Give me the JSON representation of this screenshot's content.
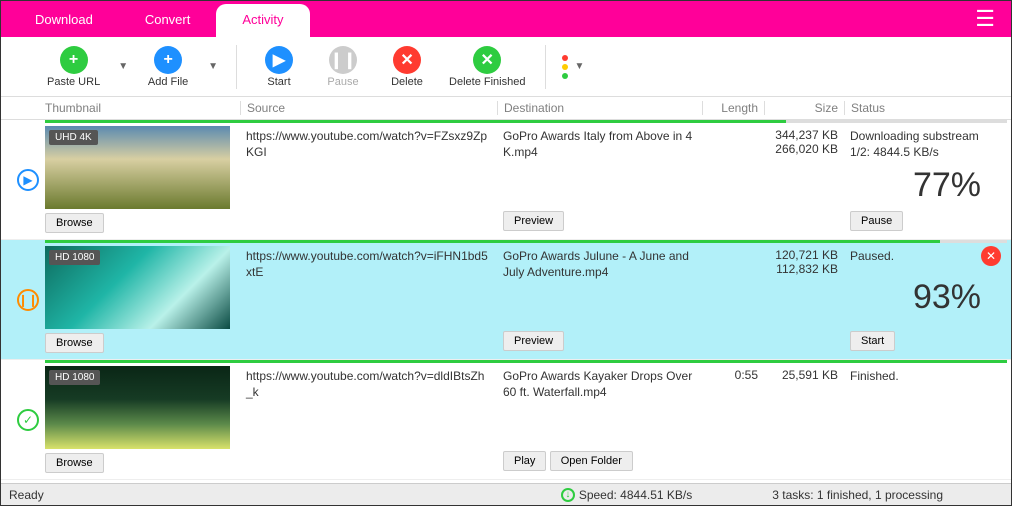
{
  "tabs": {
    "download": "Download",
    "convert": "Convert",
    "activity": "Activity"
  },
  "toolbar": {
    "paste_url": "Paste URL",
    "add_file": "Add File",
    "start": "Start",
    "pause": "Pause",
    "delete": "Delete",
    "delete_finished": "Delete Finished"
  },
  "headers": {
    "thumbnail": "Thumbnail",
    "source": "Source",
    "destination": "Destination",
    "length": "Length",
    "size": "Size",
    "status": "Status"
  },
  "rows": [
    {
      "state": "downloading",
      "state_color": "#1e90ff",
      "badge": "UHD 4K",
      "source": "https://www.youtube.com/watch?v=FZsxz9ZpKGI",
      "destination": "GoPro Awards  Italy from Above in 4K.mp4",
      "length": "",
      "size_lines": [
        "344,237 KB",
        "266,020 KB"
      ],
      "status": "Downloading substream 1/2: 4844.5 KB/s",
      "percent": "77%",
      "progress": 77,
      "browse": "Browse",
      "preview": "Preview",
      "action": "Pause"
    },
    {
      "state": "paused",
      "state_color": "#ff8c00",
      "badge": "HD 1080",
      "selected": true,
      "source": "https://www.youtube.com/watch?v=iFHN1bd5xtE",
      "destination": "GoPro Awards  Julune - A June and July Adventure.mp4",
      "length": "",
      "size_lines": [
        "120,721 KB",
        "112,832 KB"
      ],
      "status": "Paused.",
      "percent": "93%",
      "progress": 93,
      "browse": "Browse",
      "preview": "Preview",
      "action": "Start",
      "close": true
    },
    {
      "state": "finished",
      "state_color": "#2ecc40",
      "badge": "HD 1080",
      "source": "https://www.youtube.com/watch?v=dldIBtsZh_k",
      "destination": "GoPro Awards  Kayaker Drops Over 60 ft. Waterfall.mp4",
      "length": "0:55",
      "size_lines": [
        "25,591 KB"
      ],
      "status": "Finished.",
      "percent": "",
      "progress": 100,
      "browse": "Browse",
      "play": "Play",
      "open_folder": "Open Folder"
    }
  ],
  "statusbar": {
    "ready": "Ready",
    "speed": "Speed: 4844.51 KB/s",
    "tasks": "3 tasks: 1 finished, 1 processing"
  },
  "thumb_gradients": [
    "linear-gradient(180deg,#5b8ab0 0%,#d8cfa2 40%,#6b7a2e 100%)",
    "linear-gradient(135deg,#0e6b5e 0%,#1fb5a6 40%,#b9f1e9 70%,#0a4b43 100%)",
    "linear-gradient(180deg,#0a2616 0%,#163b24 40%,#5c8a4a 70%,#d8e26b 100%)"
  ]
}
